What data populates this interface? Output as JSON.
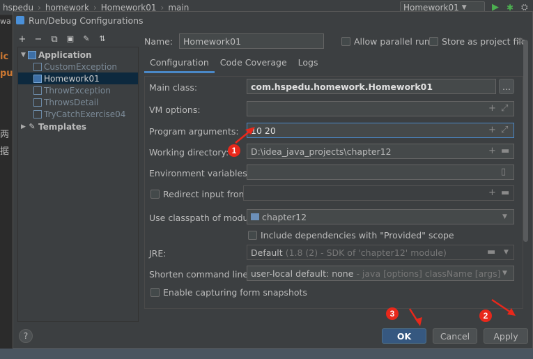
{
  "ide": {
    "breadcrumbs": [
      "hspedu",
      "homework",
      "Homework01",
      "main"
    ],
    "run_config": "Homework01",
    "left_chars": [
      "ic",
      "pu",
      "两",
      "据"
    ],
    "left_top": "wa"
  },
  "dialog": {
    "title": "Run/Debug Configurations",
    "tree_toolbar": [
      "+",
      "−",
      "⧉",
      "💾",
      "🔧",
      "⇅"
    ],
    "tree": {
      "application": "Application",
      "items": [
        "CustomException",
        "Homework01",
        "ThrowException",
        "ThrowsDetail",
        "TryCatchExercise04"
      ],
      "templates": "Templates"
    },
    "name_label": "Name:",
    "name_value": "Homework01",
    "allow_parallel_label": "Allow parallel run",
    "store_project_label": "Store as project file",
    "tabs": [
      "Configuration",
      "Code Coverage",
      "Logs"
    ],
    "form": {
      "main_class_label": "Main class:",
      "main_class_value": "com.hspedu.homework.Homework01",
      "browse_label": "...",
      "vm_options_label": "VM options:",
      "vm_options_value": "",
      "program_args_label": "Program arguments:",
      "program_args_value": "10 20",
      "working_dir_label": "Working directory:",
      "working_dir_value": "D:\\idea_java_projects\\chapter12",
      "env_vars_label": "Environment variables:",
      "env_vars_value": "",
      "redirect_label": "Redirect input from:",
      "classpath_label": "Use classpath of module:",
      "classpath_value": "chapter12",
      "include_deps_label": "Include dependencies with \"Provided\" scope",
      "jre_label": "JRE:",
      "jre_value": "Default",
      "jre_detail": "(1.8 (2) - SDK of 'chapter12' module)",
      "shorten_label": "Shorten command line:",
      "shorten_value": "user-local default: none",
      "shorten_detail": "- java [options] className [args]",
      "snapshots_label": "Enable capturing form snapshots"
    },
    "buttons": {
      "help": "?",
      "ok": "OK",
      "cancel": "Cancel",
      "apply": "Apply"
    }
  },
  "annotations": [
    "1",
    "2",
    "3"
  ],
  "colors": {
    "annotation": "#e8281b",
    "primary_button": "#365880",
    "selection": "#0d293e"
  }
}
